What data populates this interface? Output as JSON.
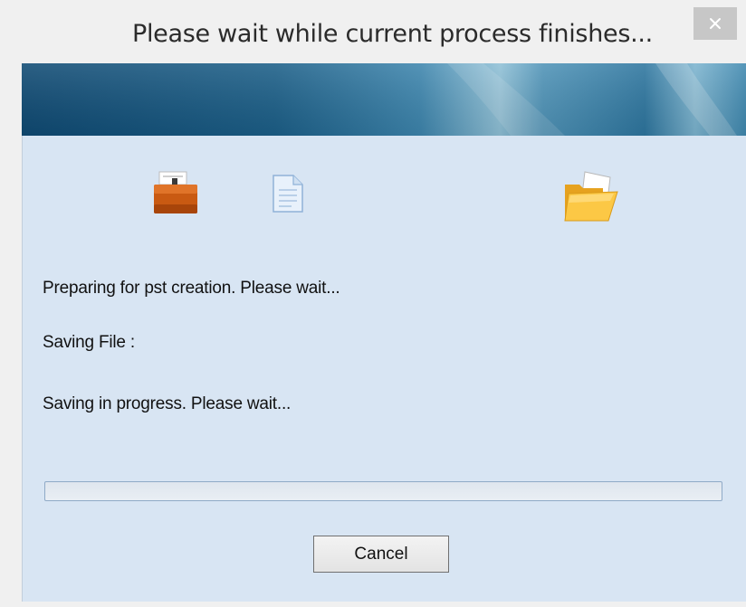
{
  "window": {
    "title": "Please wait while current process finishes...",
    "close_symbol": "×"
  },
  "icons": {
    "source": "briefcase-icon",
    "document": "document-icon",
    "destination": "folder-icon"
  },
  "status": {
    "line1": "Preparing for pst creation. Please wait...",
    "line2": "Saving File :",
    "line3": "Saving in progress. Please wait..."
  },
  "progress": {
    "value_percent": 0
  },
  "buttons": {
    "cancel_label": "Cancel"
  },
  "colors": {
    "client_bg": "#d8e5f3",
    "banner_dark": "#0f4a73",
    "banner_light": "#5aa0c4"
  }
}
